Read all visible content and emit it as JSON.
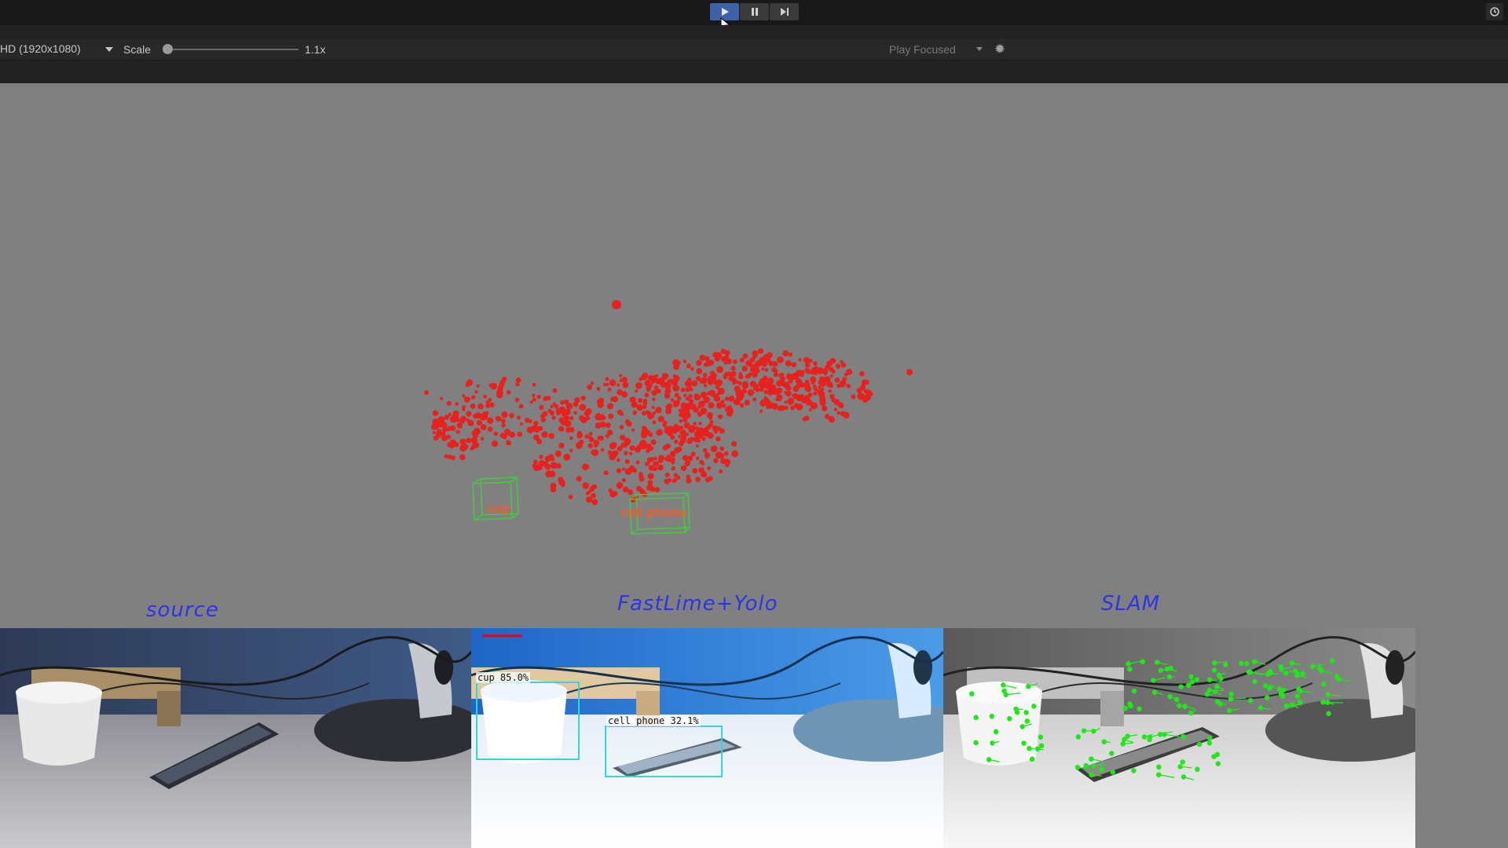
{
  "toolbar": {
    "resolution": "HD (1920x1080)",
    "scale_label": "Scale",
    "scale_value": "1.1x",
    "play_focused": "Play Focused"
  },
  "icons": {
    "play": "play-icon",
    "pause": "pause-icon",
    "step": "step-icon",
    "history": "history-icon",
    "debug": "bug-icon"
  },
  "scene": {
    "labels": [
      "cup",
      "cell phone"
    ]
  },
  "captions": {
    "source": "source",
    "fastlime": "FastLime+Yolo",
    "slam": "SLAM"
  },
  "detections": [
    {
      "label": "cup 85.0%"
    },
    {
      "label": "cell phone 32.1%"
    }
  ],
  "colors": {
    "caption": "#2f34e6",
    "points": "#e8211e",
    "boxes3d": "#3fd13a",
    "det_box": "#2fd6de",
    "features": "#22e51b",
    "play_active": "#3f62a6"
  }
}
